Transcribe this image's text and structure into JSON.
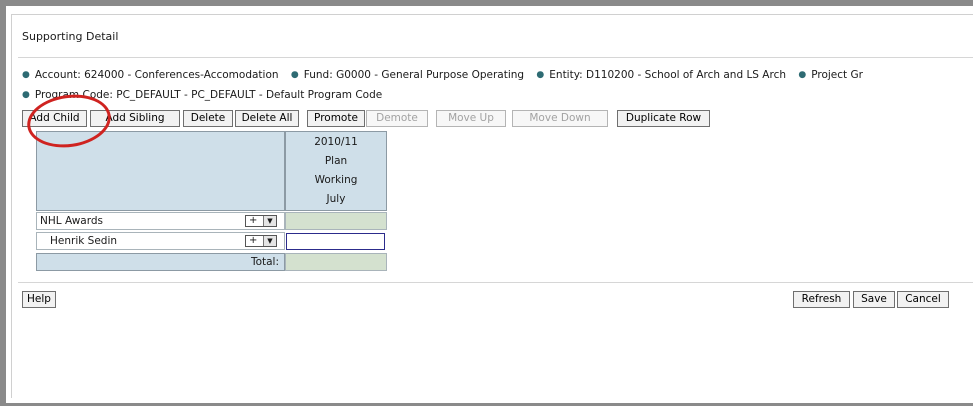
{
  "panel": {
    "title": "Supporting Detail"
  },
  "info": {
    "line1": [
      "Account: 624000 - Conferences-Accomodation",
      "Fund: G0000 - General Purpose Operating",
      "Entity: D110200 - School of Arch and LS Arch",
      "Project Gr"
    ],
    "line2": "Program Code: PC_DEFAULT - PC_DEFAULT - Default Program Code"
  },
  "toolbar": {
    "add_child": "Add Child",
    "add_sibling": "Add Sibling",
    "delete": "Delete",
    "delete_all": "Delete All",
    "promote": "Promote",
    "demote": "Demote",
    "move_up": "Move Up",
    "move_down": "Move Down",
    "duplicate_row": "Duplicate Row"
  },
  "grid": {
    "column_header": [
      "2010/11",
      "Plan",
      "Working",
      "July"
    ],
    "rows": [
      {
        "label": "NHL Awards",
        "control": "+"
      },
      {
        "label": "Henrik Sedin",
        "control": "+"
      }
    ],
    "total_label": "Total:"
  },
  "footer": {
    "help": "Help",
    "refresh": "Refresh",
    "save": "Save",
    "cancel": "Cancel"
  },
  "annotation": {
    "color": "#cf2320"
  }
}
